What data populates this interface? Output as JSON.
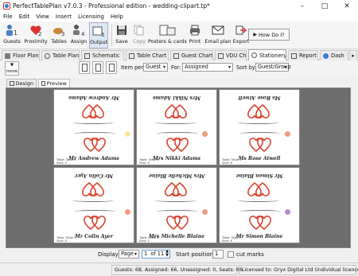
{
  "window": {
    "title": "PerfectTablePlan v7.0.3 - Professional edition - wedding-clipart.tp*",
    "minimize": "–",
    "maximize": "□",
    "close": "✕"
  },
  "menu": [
    "File",
    "Edit",
    "View",
    "Insert",
    "Licensing",
    "Help"
  ],
  "toolbar": {
    "guests": "Guests",
    "proximity": "Proximity",
    "tables": "Tables",
    "assign": "Assign",
    "output": "Output",
    "save": "Save",
    "copy": "Copy",
    "posters": "Posters & cards",
    "print": "Print",
    "email": "Email plan",
    "export": "Export",
    "howdo": "How Do I?"
  },
  "tabs": [
    "Floor Plan",
    "Table Plan",
    "Schematic",
    "Table Chart",
    "Guest Chart",
    "VDU Chart",
    "Stationery",
    "Report",
    "Dash"
  ],
  "options": {
    "more_label": "more",
    "item_per_label": "Item per:",
    "item_per_value": "Guest",
    "for_label": "For:",
    "for_value": "Assigned",
    "sort_by_label": "Sort by:",
    "sort_by_value": "Guest/Group"
  },
  "subtabs": {
    "design": "Design",
    "preview": "Preview"
  },
  "cards": [
    {
      "name": "Mr Andrew Adams",
      "table_line": "Table: Table 4",
      "seat_line": "Seat: 4",
      "dot_color": "#f6e79a"
    },
    {
      "name": "Mrs Nikki Adams",
      "table_line": "Table: Table 4",
      "seat_line": "Seat: 8",
      "dot_color": "#f29a7f"
    },
    {
      "name": "Ms Rose Atwell",
      "table_line": "Table: Table 3",
      "seat_line": "Seat: 6",
      "dot_color": "#f29a7f"
    },
    {
      "name": "Mr Colin Ayer",
      "table_line": "Table: Table 1",
      "seat_line": "Seat: 8",
      "dot_color": "#f29a7f"
    },
    {
      "name": "Mrs Michelle Blaine",
      "table_line": "Table: Table 3",
      "seat_line": "Seat: 1",
      "dot_color": "#f29a7f"
    },
    {
      "name": "Mr Simon Blaine",
      "table_line": "Table: Table 5",
      "seat_line": "Seat: 6",
      "dot_color": "#b98bd0"
    }
  ],
  "bottom": {
    "display_label": "Display:",
    "display_value": "Page",
    "page_value": "1",
    "page_total": "of 11",
    "start_position_label": "Start position:",
    "start_position_value": "1",
    "cut_marks_label": "cut marks"
  },
  "status": {
    "counts": "Guests: 68, Assigned: 66, Unassigned: 0, Seats: 66",
    "license": "Licensed to: Oryx Digital Ltd (individual licence)"
  }
}
